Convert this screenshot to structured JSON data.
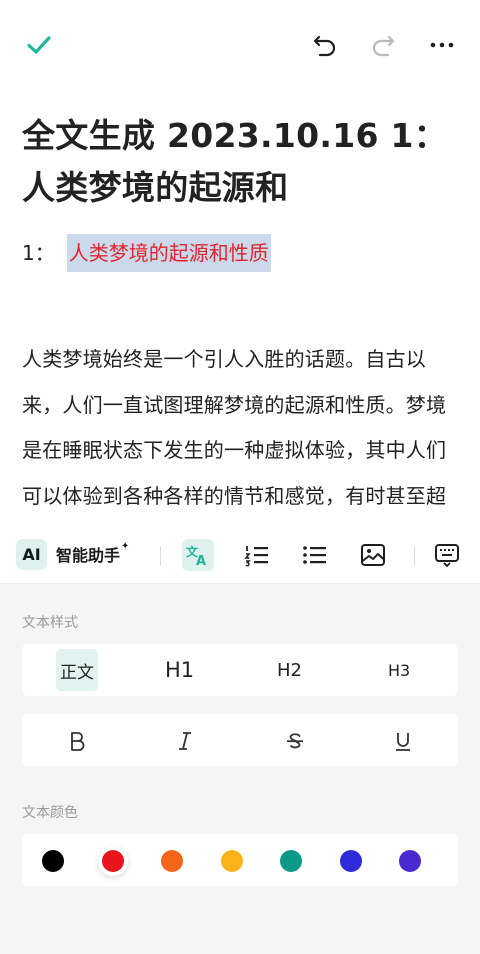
{
  "toolbar_top": {
    "confirm_icon": "check-icon",
    "undo_icon": "undo-icon",
    "redo_icon": "redo-icon",
    "more_icon": "more-icon",
    "accent": "#1db59a"
  },
  "document": {
    "title": "全文生成 2023.10.16 1：人类梦境的起源和",
    "heading_number": "1：",
    "heading_text": "人类梦境的起源和性质",
    "heading_color": "#e0262b",
    "heading_highlight": "#ccd9ec",
    "body": "人类梦境始终是一个引人入胜的话题。自古以来，人们一直试图理解梦境的起源和性质。梦境是在睡眠状态下发生的一种虚拟体验，其中人们可以体验到各种各样的情节和感觉，有时甚至超越了现实的限制。有学者"
  },
  "editor_toolbar": {
    "ai_badge": "AI",
    "ai_label": "智能助手",
    "ai_sparkle": "✦",
    "tools": [
      "translate-icon",
      "ordered-list-icon",
      "bullet-list-icon",
      "image-icon",
      "keyboard-icon"
    ]
  },
  "text_style": {
    "label": "文本样式",
    "options": [
      "正文",
      "H1",
      "H2",
      "H3"
    ],
    "selected": "正文",
    "formats": [
      "B",
      "I",
      "S",
      "U"
    ]
  },
  "text_color": {
    "label": "文本颜色",
    "colors": [
      "#000000",
      "#e8151b",
      "#f5661a",
      "#fbb31a",
      "#0b9a88",
      "#2d2ad9",
      "#4a2bd1",
      "#666666"
    ],
    "selected": "#e8151b"
  }
}
